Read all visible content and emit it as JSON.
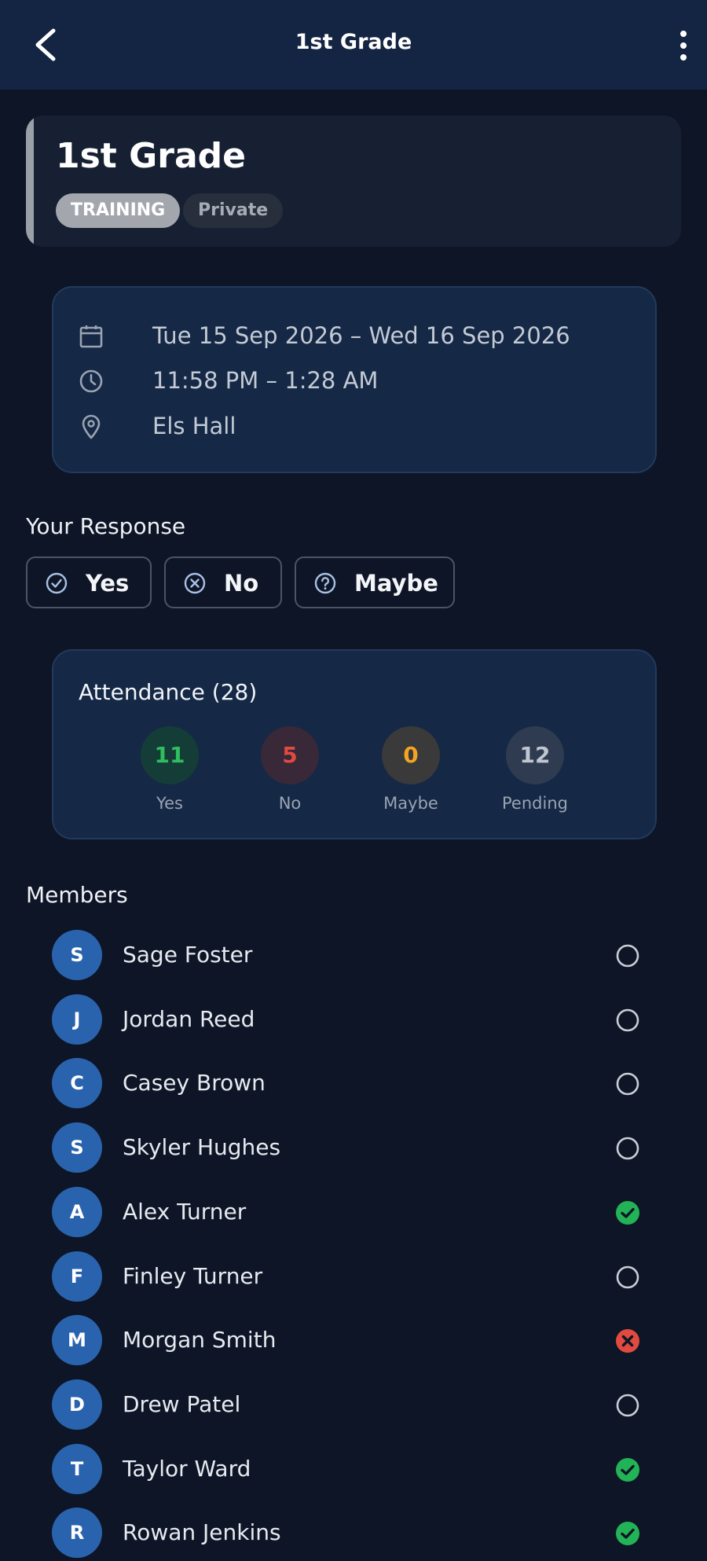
{
  "appbar": {
    "title": "1st Grade",
    "back_icon": "arrow-back-icon",
    "menu_icon": "more-vertical-icon"
  },
  "event": {
    "name": "1st Grade",
    "type_chip": "TRAINING",
    "visibility_chip": "Private",
    "accent_color": "#9aa0a8"
  },
  "details": {
    "date": "Tue 15 Sep 2026 – Wed 16 Sep 2026",
    "time": "11:58 PM – 1:28 AM",
    "location": "Els Hall"
  },
  "response": {
    "heading": "Your Response",
    "yes": "Yes",
    "no": "No",
    "maybe": "Maybe"
  },
  "attendance": {
    "title": "Attendance (28)",
    "yes_count": "11",
    "yes_label": "Yes",
    "no_count": "5",
    "no_label": "No",
    "maybe_count": "0",
    "maybe_label": "Maybe",
    "pending_count": "12",
    "pending_label": "Pending"
  },
  "members": {
    "heading": "Members",
    "items": [
      {
        "initial": "S",
        "name": "Sage Foster",
        "status": "pending"
      },
      {
        "initial": "J",
        "name": "Jordan Reed",
        "status": "pending"
      },
      {
        "initial": "C",
        "name": "Casey Brown",
        "status": "pending"
      },
      {
        "initial": "S",
        "name": "Skyler Hughes",
        "status": "pending"
      },
      {
        "initial": "A",
        "name": "Alex Turner",
        "status": "yes"
      },
      {
        "initial": "F",
        "name": "Finley Turner",
        "status": "pending"
      },
      {
        "initial": "M",
        "name": "Morgan Smith",
        "status": "no"
      },
      {
        "initial": "D",
        "name": "Drew Patel",
        "status": "pending"
      },
      {
        "initial": "T",
        "name": "Taylor Ward",
        "status": "yes"
      },
      {
        "initial": "R",
        "name": "Rowan Jenkins",
        "status": "yes"
      }
    ]
  },
  "colors": {
    "background": "#0e1526",
    "appbar": "#142443",
    "yes": "#22b356",
    "no": "#e04a3f",
    "maybe": "#f2a422",
    "avatar": "#2a63ad"
  }
}
